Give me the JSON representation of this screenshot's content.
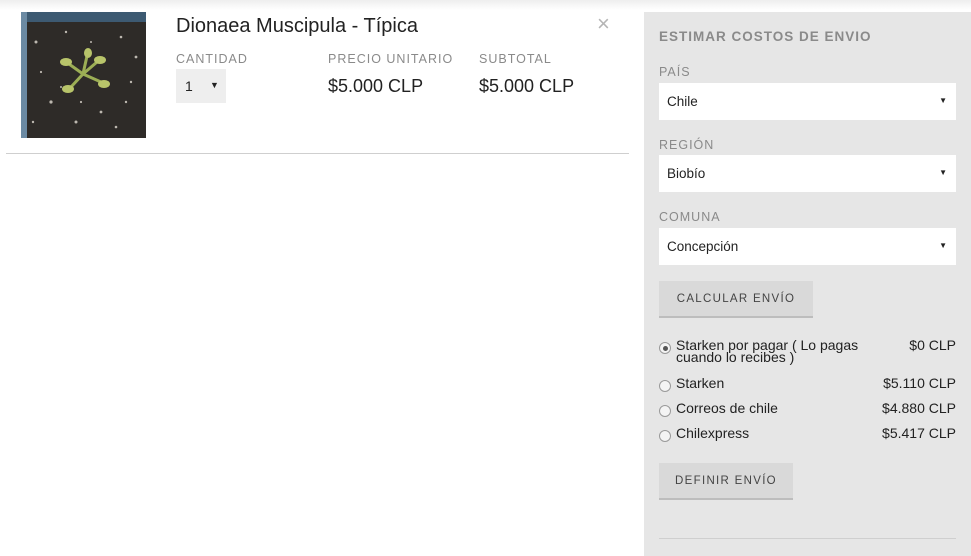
{
  "item": {
    "title": "Dionaea Muscipula - Típica",
    "image_alt": "Dionaea muscipula plant in soil",
    "close_icon": "×",
    "qty_label": "CANTIDAD",
    "qty_value": "1",
    "unit_price_label": "PRECIO UNITARIO",
    "unit_price": "$5.000 CLP",
    "subtotal_label": "SUBTOTAL",
    "subtotal": "$5.000 CLP"
  },
  "shipping": {
    "title": "ESTIMAR COSTOS DE ENVIO",
    "country_label": "PAÍS",
    "country_value": "Chile",
    "region_label": "REGIÓN",
    "region_value": "Biobío",
    "comuna_label": "COMUNA",
    "comuna_value": "Concepción",
    "calculate_label": "CALCULAR ENVÍO",
    "options": [
      {
        "label": "Starken por pagar ( Lo pagas cuando lo recibes )",
        "price": "$0 CLP",
        "selected": true
      },
      {
        "label": "Starken",
        "price": "$5.110 CLP",
        "selected": false
      },
      {
        "label": "Correos de chile",
        "price": "$4.880 CLP",
        "selected": false
      },
      {
        "label": "Chilexpress",
        "price": "$5.417 CLP",
        "selected": false
      }
    ],
    "define_label": "DEFINIR ENVÍO"
  },
  "icons": {
    "close": "close-icon",
    "caret": "caret-down-icon",
    "radio": "radio-icon"
  },
  "colors": {
    "panel_bg": "#e6e6e6",
    "button_bg": "#d9d9d9",
    "label_gray": "#8a8a8a"
  }
}
